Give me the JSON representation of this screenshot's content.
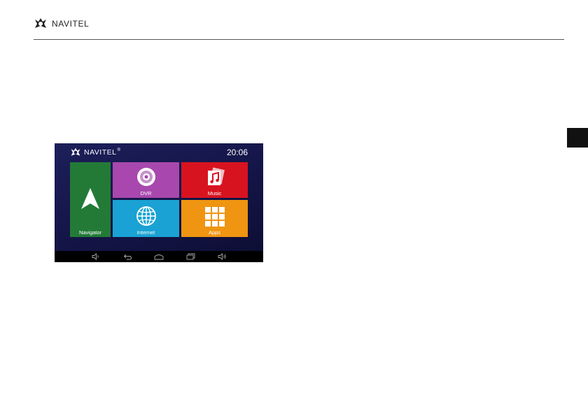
{
  "page": {
    "brand": "NAVITEL"
  },
  "device": {
    "brand": "NAVITEL",
    "brand_mark": "®",
    "clock": "20:06",
    "tiles": [
      {
        "label": "Navigator",
        "icon": "navigator-arrow-icon",
        "color": "#237a37"
      },
      {
        "label": "DVR",
        "icon": "dvr-camera-icon",
        "color": "#a848ae"
      },
      {
        "label": "Music",
        "icon": "music-note-icon",
        "color": "#d81320"
      },
      {
        "label": "Internet",
        "icon": "globe-icon",
        "color": "#1aa2d4"
      },
      {
        "label": "Apps",
        "icon": "apps-grid-icon",
        "color": "#ef9511"
      }
    ],
    "navbar_icons": [
      "volume-down-icon",
      "back-icon",
      "home-icon",
      "recent-apps-icon",
      "volume-up-icon"
    ]
  }
}
